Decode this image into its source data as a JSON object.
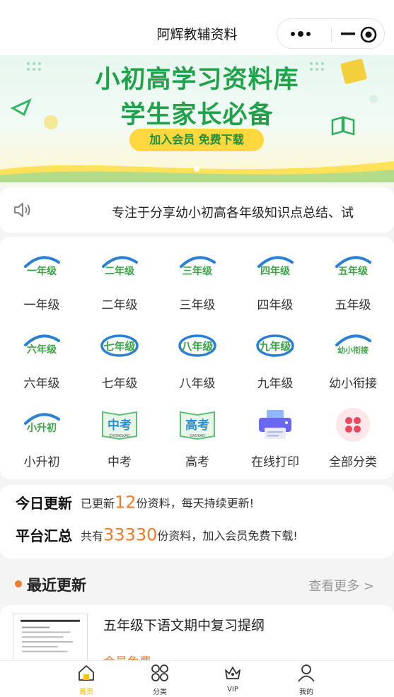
{
  "app": {
    "title": "阿辉教辅资料"
  },
  "colors": {
    "brand_green": "#1fa24a",
    "accent_orange": "#f27b2a",
    "cta_yellow": "#ffd73e",
    "active_tab": "#e9b200"
  },
  "banner": {
    "line1": "小初高学习资料库",
    "line2": "学生家长必备",
    "cta": "加入会员  免费下载"
  },
  "notice": {
    "text": "专注于分享幼小初高各年级知识点总结、试"
  },
  "categories": [
    {
      "label": "一年级",
      "badge": "一年级"
    },
    {
      "label": "二年级",
      "badge": "二年级"
    },
    {
      "label": "三年级",
      "badge": "三年级"
    },
    {
      "label": "四年级",
      "badge": "四年级"
    },
    {
      "label": "五年级",
      "badge": "五年级"
    },
    {
      "label": "六年级",
      "badge": "六年级"
    },
    {
      "label": "七年级",
      "badge": "七年级"
    },
    {
      "label": "八年级",
      "badge": "八年级"
    },
    {
      "label": "九年级",
      "badge": "九年级"
    },
    {
      "label": "幼小衔接",
      "badge": "幼小衔接"
    },
    {
      "label": "小升初",
      "badge": "小升初"
    },
    {
      "label": "中考",
      "badge": "中考",
      "sub": "ZHONGKAO"
    },
    {
      "label": "高考",
      "badge": "高考",
      "sub": "GAOKAO"
    },
    {
      "label": "在线打印",
      "icon": "printer-icon"
    },
    {
      "label": "全部分类",
      "icon": "grid-icon"
    }
  ],
  "stats": {
    "today": {
      "key": "今日更新",
      "pre": "已更新",
      "num": "12",
      "post": "份资料，每天持续更新!"
    },
    "total": {
      "key": "平台汇总",
      "pre": "共有",
      "num": "33330",
      "post": "份资料，加入会员免费下载!"
    }
  },
  "recent": {
    "heading": "最近更新",
    "more": "查看更多 >",
    "item": {
      "title": "五年级下语文期中复习提纲",
      "price": "会员免费"
    }
  },
  "tabbar": [
    {
      "label": "首页",
      "icon": "home-icon",
      "active": true
    },
    {
      "label": "分类",
      "icon": "category-icon",
      "active": false
    },
    {
      "label": "VIP",
      "icon": "crown-icon",
      "active": false
    },
    {
      "label": "我的",
      "icon": "user-icon",
      "active": false
    }
  ]
}
